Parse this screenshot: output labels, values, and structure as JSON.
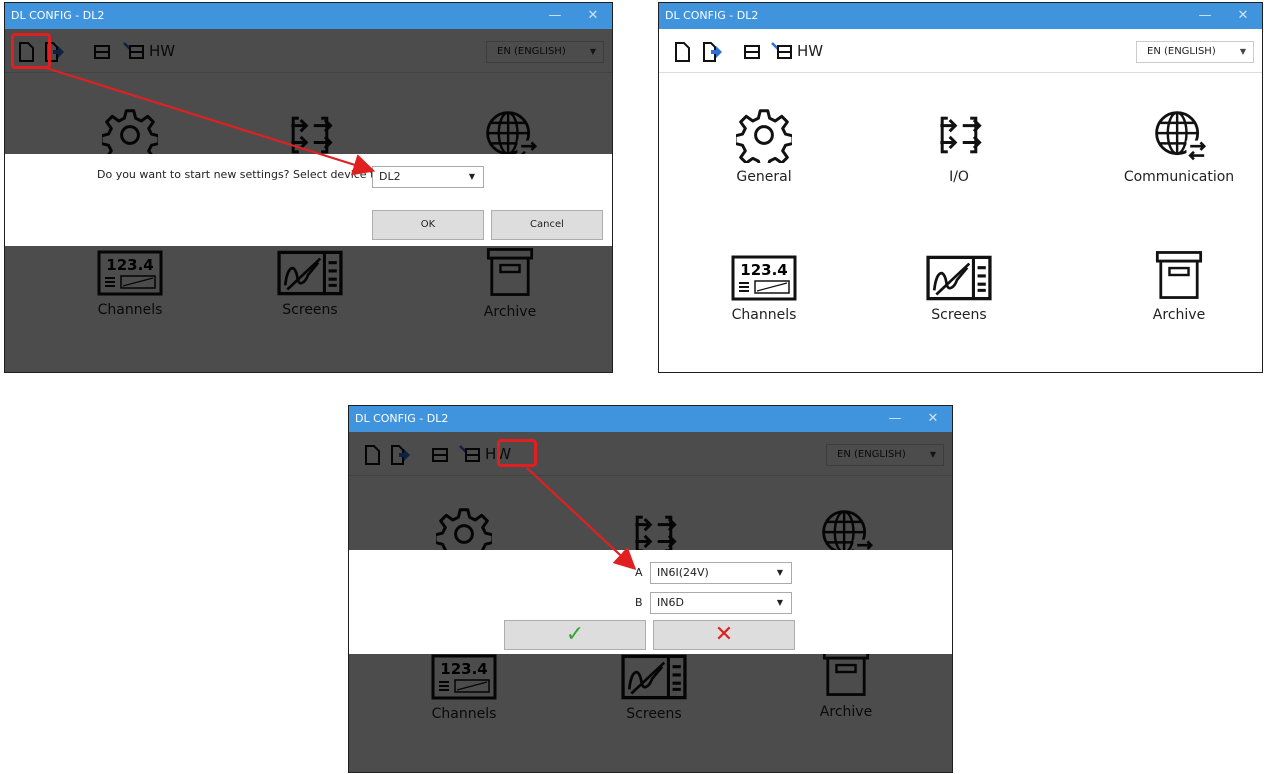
{
  "window_title": "DL CONFIG - DL2",
  "titlebar": {
    "minimize": "—",
    "close": "✕"
  },
  "toolbar": {
    "icons": [
      "new-file-icon",
      "open-file-icon",
      "save-icon",
      "send-to-device-icon"
    ],
    "hw_label": "HW",
    "language": "EN (ENGLISH)"
  },
  "tiles": {
    "general": "General",
    "io": "I/O",
    "communication": "Communication",
    "channels": "Channels",
    "channels_icon_value": "123.4",
    "screens": "Screens",
    "archive": "Archive"
  },
  "new_settings_dialog": {
    "prompt": "Do you want to start new settings? Select device type.",
    "device_type": "DL2",
    "ok": "OK",
    "cancel": "Cancel"
  },
  "hw_dialog": {
    "slots": [
      {
        "label": "A",
        "value": "IN6I(24V)"
      },
      {
        "label": "B",
        "value": "IN6D"
      }
    ],
    "confirm_symbol": "✓",
    "cancel_symbol": "✕"
  },
  "colors": {
    "titlebar": "#3f94dd",
    "highlight": "#e02020",
    "confirm": "#3aa535",
    "cancel": "#e02020"
  }
}
